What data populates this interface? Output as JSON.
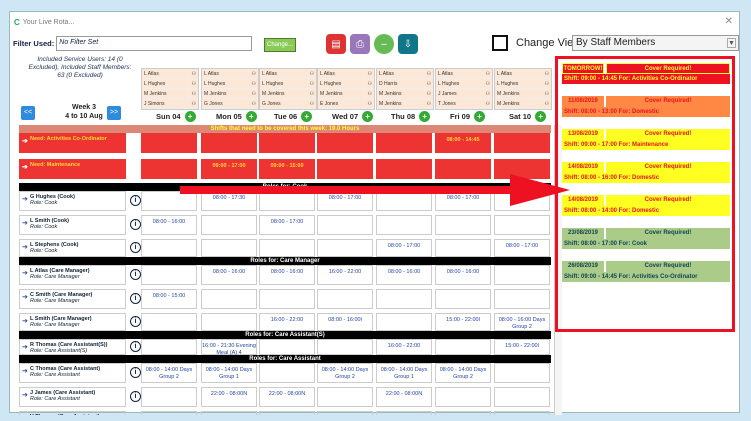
{
  "window": {
    "title": "Your Live Rota..."
  },
  "filter": {
    "label": "Filter Used:",
    "value": "No Filter Set",
    "change_label": "Change..."
  },
  "toolbar": {
    "colors": {
      "pdf": "#d33",
      "print": "#97b",
      "refresh": "#6b5",
      "export": "#178"
    }
  },
  "change_view": {
    "label": "Change View:",
    "selected": "By Staff Members"
  },
  "summary": {
    "text": "Included Service Users: 14 (0 Excluded), Included Staff Members: 63 (0 Excluded)"
  },
  "week": {
    "prev": "<<",
    "next": ">>",
    "label": "Week 3",
    "range": "4 to 10 Aug"
  },
  "staff_columns": [
    [
      "L Atlas",
      "L Hughes",
      "M Jenkins",
      "J Simons"
    ],
    [
      "L Atlas",
      "L Hughes",
      "M Jenkins",
      "G Jones"
    ],
    [
      "L Atlas",
      "L Hughes",
      "M Jenkins",
      "G Jones"
    ],
    [
      "L Atlas",
      "L Hughes",
      "M Jenkins",
      "E Jones"
    ],
    [
      "L Atlas",
      "D Harris",
      "M Jenkins",
      "M Jenkins"
    ],
    [
      "L Atlas",
      "L Hughes",
      "J James",
      "T Jones"
    ],
    [
      "L Atlas",
      "L Hughes",
      "M Jenkins",
      "M Jenkins"
    ]
  ],
  "days": [
    "Sun 04",
    "Mon 05",
    "Tue 06",
    "Wed 07",
    "Thu 08",
    "Fri 09",
    "Sat 10"
  ],
  "bands": {
    "shifts": "Shifts that need to be covered this week: 19.0 Hours",
    "cook": "Roles for: Cook",
    "care_manager": "Roles for: Care Manager",
    "care_assistant_s": "Roles for: Care Assistant(S)",
    "care_assistant": "Roles for: Care Assistant"
  },
  "req_rows": [
    {
      "name": "Need: Activities Co-Ordinator",
      "cells": [
        "",
        "",
        "",
        "",
        "",
        "08:00 - 14:45",
        ""
      ]
    },
    {
      "name": "Need: Maintenance",
      "cells": [
        "",
        "09:00 - 17:00",
        "09:00 - 15:00",
        "",
        "",
        "",
        ""
      ]
    }
  ],
  "staff_rows": [
    {
      "name": "G Hughes (Cook)",
      "role": "Role: Cook",
      "cells": [
        "",
        "08:00 - 17:30",
        "",
        "08:00 - 17:00",
        "",
        "08:00 - 17:00",
        ""
      ]
    },
    {
      "name": "L Smith (Cook)",
      "role": "Role: Cook",
      "cells": [
        "08:00 - 16:00",
        "",
        "08:00 - 17:00",
        "",
        "",
        "",
        ""
      ]
    },
    {
      "name": "L Stephens (Cook)",
      "role": "Role: Cook",
      "cells": [
        "",
        "",
        "",
        "",
        "08:00 - 17:00",
        "",
        "08:00 - 17:00"
      ]
    },
    {
      "name": "L Atlas (Care Manager)",
      "role": "Role: Care Manager",
      "cells": [
        "",
        "08:00 - 16:00",
        "08:00 - 16:00",
        "16:00 - 22:00",
        "08:00 - 16:00",
        "08:00 - 16:00",
        ""
      ]
    },
    {
      "name": "C Smith (Care Manager)",
      "role": "Role: Care Manager",
      "cells": [
        "08:00 - 15:00",
        "",
        "",
        "",
        "",
        "",
        ""
      ]
    },
    {
      "name": "L Smith (Care Manager)",
      "role": "Role: Care Manager",
      "cells": [
        "",
        "",
        "16:00 - 22:00",
        "08:00 - 16:00l",
        "",
        "15:00 - 22:00l",
        "08:00 - 16:00 Days Group 2"
      ]
    },
    {
      "name": "R Thomas (Care Assistant(S))",
      "role": "Role: Care Assistant(S)",
      "cells": [
        "",
        "16:00 - 21:30 Evening Meal (A) 4",
        "",
        "",
        "16:00 - 22:00",
        "",
        "15:00 - 22:00l"
      ]
    },
    {
      "name": "C Thomas (Care Assistant)",
      "role": "Role: Care Assistant",
      "cells": [
        "08:00 - 14:00 Days Group 2",
        "08:00 - 14:00 Days Group 1",
        "",
        "08:00 - 14:00 Days Group 2",
        "08:00 - 14:00 Days Group 1",
        "08:00 - 14:00 Days Group 2",
        ""
      ]
    },
    {
      "name": "J James (Care Assistant)",
      "role": "Role: Care Assistant",
      "cells": [
        "",
        "22:00 - 08:00N",
        "22:00 - 08:00N",
        "",
        "22:00 - 08:00N",
        "",
        ""
      ]
    },
    {
      "name": "V Thomas (Care Assistant)",
      "role": "Role: Care Assistant",
      "cells": [
        "08:00 - 14:00 Days Group 2",
        "08:00 - 15:00 Days Group 1",
        "",
        "",
        "",
        "08:00 - 16:00 Days Group 1",
        "08:00 - 14:00 Days Group 1"
      ]
    }
  ],
  "alerts": [
    {
      "date": "TOMORROW!",
      "status": "Cover Required!",
      "shift": "Shift: 09:00 - 14:45 For: Activities Co-Ordinator",
      "bg": "#e12",
      "fg": "#ff3"
    },
    {
      "date": "11/08/2019",
      "status": "Cover Required!",
      "shift": "Shift: 08:00 - 13:00 For: Domestic",
      "bg": "#f84",
      "fg": "#e12"
    },
    {
      "date": "13/08/2019",
      "status": "Cover Required!",
      "shift": "Shift: 09:00 - 17:00 For: Maintenance",
      "bg": "#ff2",
      "fg": "#e12"
    },
    {
      "date": "14/08/2019",
      "status": "Cover Required!",
      "shift": "Shift: 08:00 - 16:00 For: Domestic",
      "bg": "#ff2",
      "fg": "#e12"
    },
    {
      "date": "14/08/2019",
      "status": "Cover Required!",
      "shift": "Shift: 08:00 - 14:00 For: Domestic",
      "bg": "#ff2",
      "fg": "#e12"
    },
    {
      "date": "23/08/2019",
      "status": "Cover Required!",
      "shift": "Shift: 08:00 - 17:00 For: Cook",
      "bg": "#ac8",
      "fg": "#145"
    },
    {
      "date": "26/08/2019",
      "status": "Cover Required!",
      "shift": "Shift: 09:00 - 14:45 For: Activities Co-Ordinator",
      "bg": "#ac8",
      "fg": "#145"
    }
  ]
}
